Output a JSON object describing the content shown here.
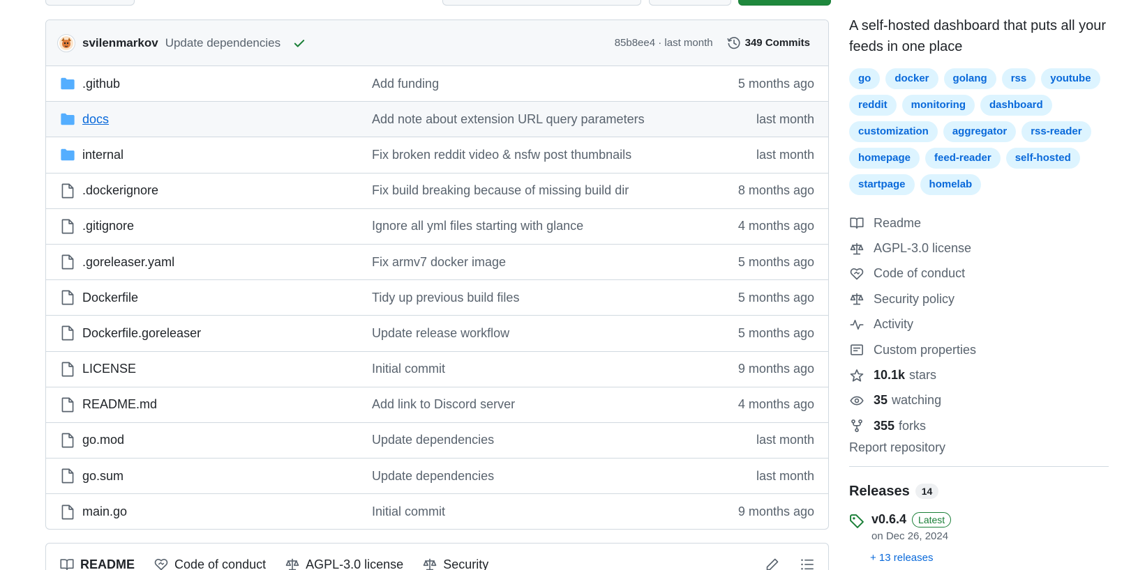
{
  "colors": {
    "link": "#0969da",
    "muted": "#59636e",
    "text": "#1f2328",
    "green": "#1a7f37",
    "border": "#d1d9e0",
    "folder": "#54aeff"
  },
  "latest_commit": {
    "author": "svilenmarkov",
    "message": "Update dependencies",
    "sha_time": "85b8ee4 · last month",
    "commits_label": "349 Commits"
  },
  "files": [
    {
      "name": ".github",
      "type": "folder",
      "message": "Add funding",
      "age": "5 months ago"
    },
    {
      "name": "docs",
      "type": "folder",
      "message": "Add note about extension URL query parameters",
      "age": "last month"
    },
    {
      "name": "internal",
      "type": "folder",
      "message": "Fix broken reddit video & nsfw post thumbnails",
      "age": "last month"
    },
    {
      "name": ".dockerignore",
      "type": "file",
      "message": "Fix build breaking because of missing build dir",
      "age": "8 months ago"
    },
    {
      "name": ".gitignore",
      "type": "file",
      "message": "Ignore all yml files starting with glance",
      "age": "4 months ago"
    },
    {
      "name": ".goreleaser.yaml",
      "type": "file",
      "message": "Fix armv7 docker image",
      "age": "5 months ago"
    },
    {
      "name": "Dockerfile",
      "type": "file",
      "message": "Tidy up previous build files",
      "age": "5 months ago"
    },
    {
      "name": "Dockerfile.goreleaser",
      "type": "file",
      "message": "Update release workflow",
      "age": "5 months ago"
    },
    {
      "name": "LICENSE",
      "type": "file",
      "message": "Initial commit",
      "age": "9 months ago"
    },
    {
      "name": "README.md",
      "type": "file",
      "message": "Add link to Discord server",
      "age": "4 months ago"
    },
    {
      "name": "go.mod",
      "type": "file",
      "message": "Update dependencies",
      "age": "last month"
    },
    {
      "name": "go.sum",
      "type": "file",
      "message": "Update dependencies",
      "age": "last month"
    },
    {
      "name": "main.go",
      "type": "file",
      "message": "Initial commit",
      "age": "9 months ago"
    }
  ],
  "readme_tabs": [
    {
      "label": "README",
      "icon": "book-icon"
    },
    {
      "label": "Code of conduct",
      "icon": "heart-icon"
    },
    {
      "label": "AGPL-3.0 license",
      "icon": "law-icon"
    },
    {
      "label": "Security",
      "icon": "law-icon"
    }
  ],
  "about": {
    "description": "A self-hosted dashboard that puts all your feeds in one place",
    "topics": [
      "go",
      "docker",
      "golang",
      "rss",
      "youtube",
      "reddit",
      "monitoring",
      "dashboard",
      "customization",
      "aggregator",
      "rss-reader",
      "homepage",
      "feed-reader",
      "self-hosted",
      "startpage",
      "homelab"
    ],
    "links": [
      {
        "icon": "book-icon",
        "label": "Readme"
      },
      {
        "icon": "law-icon",
        "label": "AGPL-3.0 license"
      },
      {
        "icon": "heart-icon",
        "label": "Code of conduct"
      },
      {
        "icon": "law-icon",
        "label": "Security policy"
      },
      {
        "icon": "pulse-icon",
        "label": "Activity"
      },
      {
        "icon": "note-icon",
        "label": "Custom properties"
      }
    ],
    "stats": [
      {
        "icon": "star-icon",
        "value": "10.1k",
        "label": "stars"
      },
      {
        "icon": "eye-icon",
        "value": "35",
        "label": "watching"
      },
      {
        "icon": "fork-icon",
        "value": "355",
        "label": "forks"
      }
    ],
    "report": "Report repository"
  },
  "releases": {
    "title": "Releases",
    "count": "14",
    "latest": {
      "version": "v0.6.4",
      "badge": "Latest",
      "date": "on Dec 26, 2024"
    },
    "more": "+ 13 releases"
  }
}
